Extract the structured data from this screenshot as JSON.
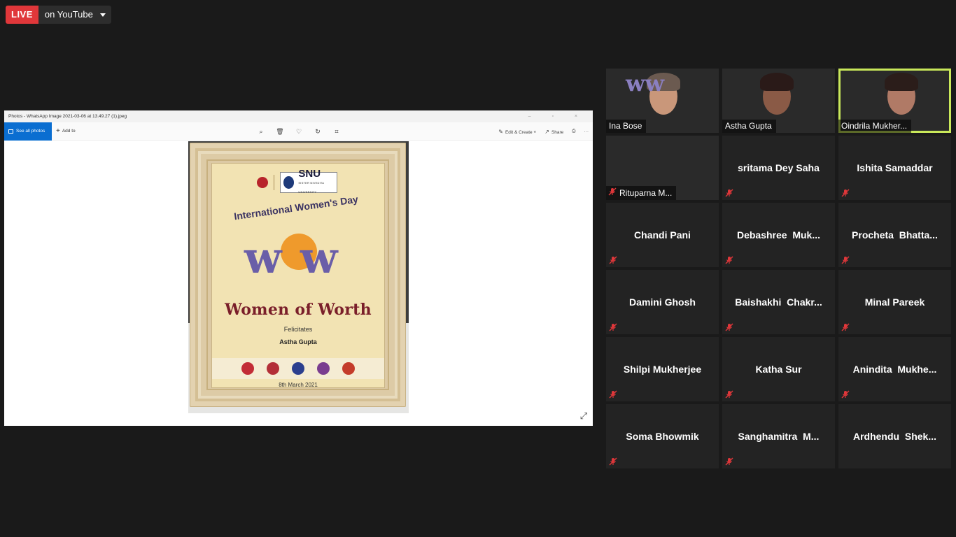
{
  "live": {
    "badge": "LIVE",
    "destination": "on YouTube"
  },
  "photos_app": {
    "title": "Photos - WhatsApp Image 2021-03-06 at 13.49.27 (1).jpeg",
    "see_all_label": "See all photos",
    "add_to_label": "Add to",
    "edit_create_label": "Edit & Create",
    "share_label": "Share",
    "more_label": "···"
  },
  "poster": {
    "arc_text": "International Women's Day",
    "main_title": "Women of Worth",
    "felicitates": "Felicitates",
    "recipient": "Astha Gupta",
    "date": "8th March 2021",
    "snu": "SNU",
    "snu_sub": "SISTER NIVEDITA UNIVERSITY"
  },
  "participants": [
    {
      "name": "Ina Bose",
      "video": true,
      "muted": false
    },
    {
      "name": "Astha Gupta",
      "video": true,
      "muted": false
    },
    {
      "name": "Oindrila Mukher...",
      "video": true,
      "muted": false,
      "active": true
    },
    {
      "name": "Rituparna M...",
      "video": true,
      "muted": true
    },
    {
      "name": "sritama Dey Saha",
      "video": false,
      "muted": true
    },
    {
      "name": "Ishita Samaddar",
      "video": false,
      "muted": true
    },
    {
      "name": "Chandi Pani",
      "video": false,
      "muted": true
    },
    {
      "name": "Debashree  Muk...",
      "video": false,
      "muted": true
    },
    {
      "name": "Procheta  Bhatta...",
      "video": false,
      "muted": true
    },
    {
      "name": "Damini Ghosh",
      "video": false,
      "muted": true
    },
    {
      "name": "Baishakhi  Chakr...",
      "video": false,
      "muted": true
    },
    {
      "name": "Minal Pareek",
      "video": false,
      "muted": true
    },
    {
      "name": "Shilpi Mukherjee",
      "video": false,
      "muted": true
    },
    {
      "name": "Katha Sur",
      "video": false,
      "muted": true
    },
    {
      "name": "Anindita  Mukhe...",
      "video": false,
      "muted": true
    },
    {
      "name": "Soma Bhowmik",
      "video": false,
      "muted": true
    },
    {
      "name": "Sanghamitra  M...",
      "video": false,
      "muted": true
    },
    {
      "name": "Ardhendu  Shek...",
      "video": false,
      "muted": false
    }
  ],
  "colors": {
    "live_red": "#e0373a",
    "active_speaker": "#c9e85a",
    "mute_red": "#e0373a",
    "accent_blue": "#0a6ed1"
  }
}
